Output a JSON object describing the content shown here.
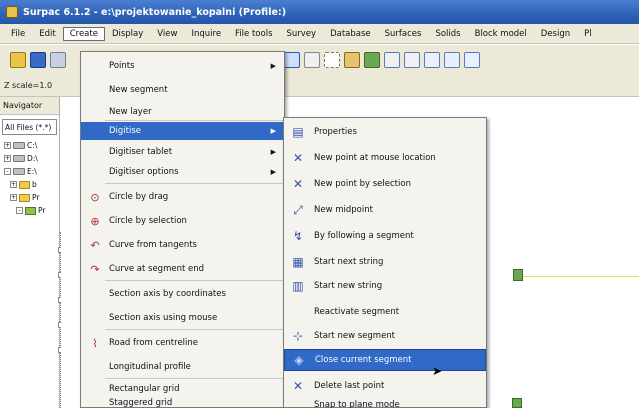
{
  "window": {
    "title": "Surpac 6.1.2 - e:\\projektowanie_kopalni (Profile:)"
  },
  "menubar": {
    "items": [
      "File",
      "Edit",
      "Create",
      "Display",
      "View",
      "Inquire",
      "File tools",
      "Survey",
      "Database",
      "Surfaces",
      "Solids",
      "Block model",
      "Design",
      "Pl"
    ]
  },
  "toolbar": {
    "zscale": "Z scale=1.0"
  },
  "navigator": {
    "title": "Navigator",
    "filter": "All Files (*.*)",
    "tree": [
      "C:\\",
      "D:\\",
      "E:\\",
      "b",
      "Pr",
      "Pr"
    ]
  },
  "create_menu": {
    "items": [
      {
        "label": "Points",
        "submenu": true
      },
      {
        "label": "New segment"
      },
      {
        "label": "New layer"
      },
      {
        "label": "Digitise",
        "submenu": true,
        "highlight": true
      },
      {
        "label": "Digitiser tablet",
        "submenu": true
      },
      {
        "label": "Digitiser options",
        "submenu": true
      },
      {
        "label": "Circle by drag",
        "icon": "circle-drag-icon"
      },
      {
        "label": "Circle by selection",
        "icon": "circle-select-icon"
      },
      {
        "label": "Curve from tangents",
        "icon": "curve-tangent-icon"
      },
      {
        "label": "Curve at segment end",
        "icon": "curve-end-icon"
      },
      {
        "label": "Section axis by coordinates"
      },
      {
        "label": "Section axis using mouse"
      },
      {
        "label": "Road from centreline",
        "icon": "road-icon"
      },
      {
        "label": "Longitudinal profile"
      },
      {
        "label": "Rectangular grid"
      },
      {
        "label": "Staggered grid"
      }
    ]
  },
  "digitise_menu": {
    "items": [
      {
        "label": "Properties",
        "icon": "properties-icon"
      },
      {
        "label": "New point at mouse location",
        "icon": "new-point-mouse-icon"
      },
      {
        "label": "New point by selection",
        "icon": "new-point-select-icon"
      },
      {
        "label": "New midpoint",
        "icon": "midpoint-icon"
      },
      {
        "label": "By following a segment",
        "icon": "follow-segment-icon"
      },
      {
        "label": "Start next string",
        "icon": "next-string-icon"
      },
      {
        "label": "Start new string",
        "icon": "new-string-icon"
      },
      {
        "label": "Reactivate segment"
      },
      {
        "label": "Start new segment",
        "icon": "new-segment-icon"
      },
      {
        "label": "Close current segment",
        "icon": "close-segment-icon",
        "highlight": true
      },
      {
        "label": "Delete last point",
        "icon": "delete-point-icon"
      },
      {
        "label": "Snap to plane mode"
      }
    ]
  }
}
